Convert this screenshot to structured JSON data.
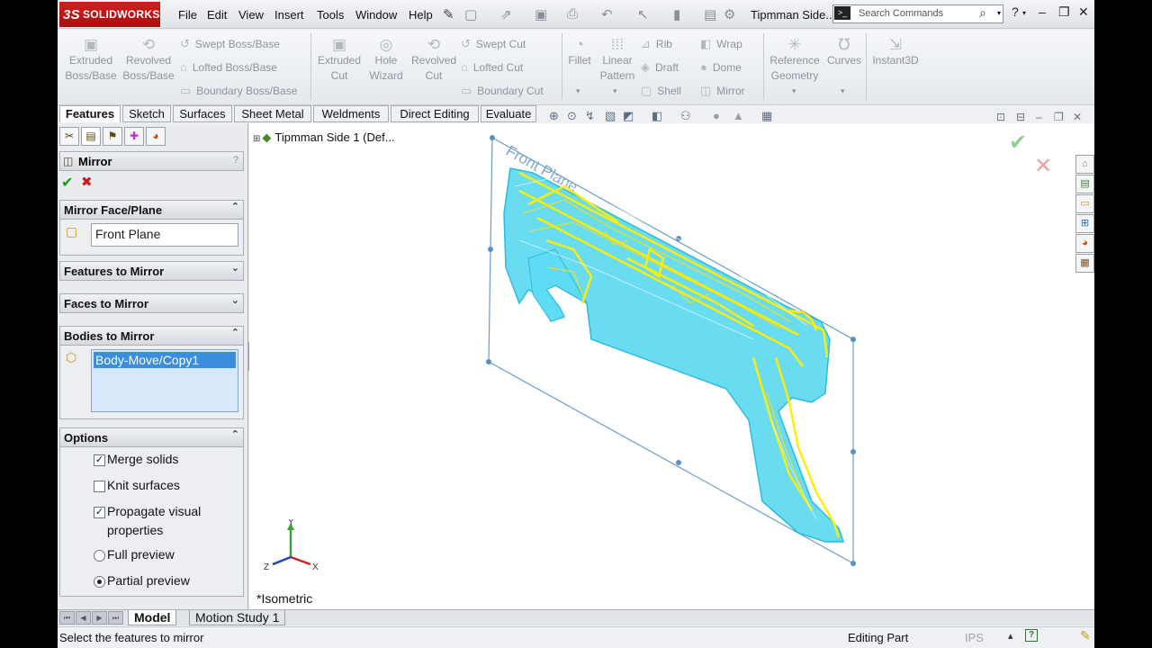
{
  "app": {
    "brand": "SOLIDWORKS",
    "brand_mark": "3S",
    "document_title": "Tipmman Side...",
    "accent_color": "#c8151b"
  },
  "menu": [
    "File",
    "Edit",
    "View",
    "Insert",
    "Tools",
    "Window",
    "Help"
  ],
  "search": {
    "placeholder": "Search Commands",
    "icon": "terminal-icon"
  },
  "command_manager": {
    "extruded_boss": "Extruded\nBoss/Base",
    "revolved_boss": "Revolved\nBoss/Base",
    "swept_boss": "Swept Boss/Base",
    "lofted_boss": "Lofted Boss/Base",
    "boundary_boss": "Boundary Boss/Base",
    "extruded_cut": "Extruded\nCut",
    "hole_wizard": "Hole\nWizard",
    "revolved_cut": "Revolved\nCut",
    "swept_cut": "Swept Cut",
    "lofted_cut": "Lofted Cut",
    "boundary_cut": "Boundary Cut",
    "fillet": "Fillet",
    "linear_pattern": "Linear\nPattern",
    "rib": "Rib",
    "draft": "Draft",
    "shell": "Shell",
    "wrap": "Wrap",
    "dome": "Dome",
    "mirror": "Mirror",
    "reference_geometry": "Reference\nGeometry",
    "curves": "Curves",
    "instant3d": "Instant3D"
  },
  "tabs": [
    {
      "label": "Features",
      "active": true
    },
    {
      "label": "Sketch"
    },
    {
      "label": "Surfaces"
    },
    {
      "label": "Sheet Metal"
    },
    {
      "label": "Weldments"
    },
    {
      "label": "Direct Editing"
    },
    {
      "label": "Evaluate"
    }
  ],
  "property_manager": {
    "title": "Mirror",
    "help": "?",
    "sections": {
      "mirror_face": {
        "title": "Mirror Face/Plane",
        "value": "Front Plane"
      },
      "features": {
        "title": "Features to Mirror"
      },
      "faces": {
        "title": "Faces to Mirror"
      },
      "bodies": {
        "title": "Bodies to Mirror",
        "selected": "Body-Move/Copy1"
      },
      "options": {
        "title": "Options"
      }
    },
    "options": {
      "merge_solids": {
        "label": "Merge solids",
        "checked": true
      },
      "knit_surfaces": {
        "label": "Knit surfaces",
        "checked": false
      },
      "propagate_1": "Propagate visual",
      "propagate_2": "properties",
      "propagate_checked": true,
      "full_preview": {
        "label": "Full preview",
        "selected": false
      },
      "partial_preview": {
        "label": "Partial preview",
        "selected": true
      }
    }
  },
  "feature_tree": {
    "root": "Tipmman Side 1  (Def..."
  },
  "viewport": {
    "plane_label": "Front Plane",
    "view_label": "*Isometric",
    "triad": {
      "x": "X",
      "y": "Y",
      "z": "Z"
    },
    "model_colors": {
      "body": "#4fd6f0",
      "edges": "#ffee00",
      "plane": "#6a9cc9"
    }
  },
  "bottom_tabs": [
    {
      "label": "Model",
      "active": true
    },
    {
      "label": "Motion Study 1"
    }
  ],
  "status": {
    "message": "Select the features to mirror",
    "mode": "Editing Part",
    "units": "IPS",
    "help": "?"
  }
}
